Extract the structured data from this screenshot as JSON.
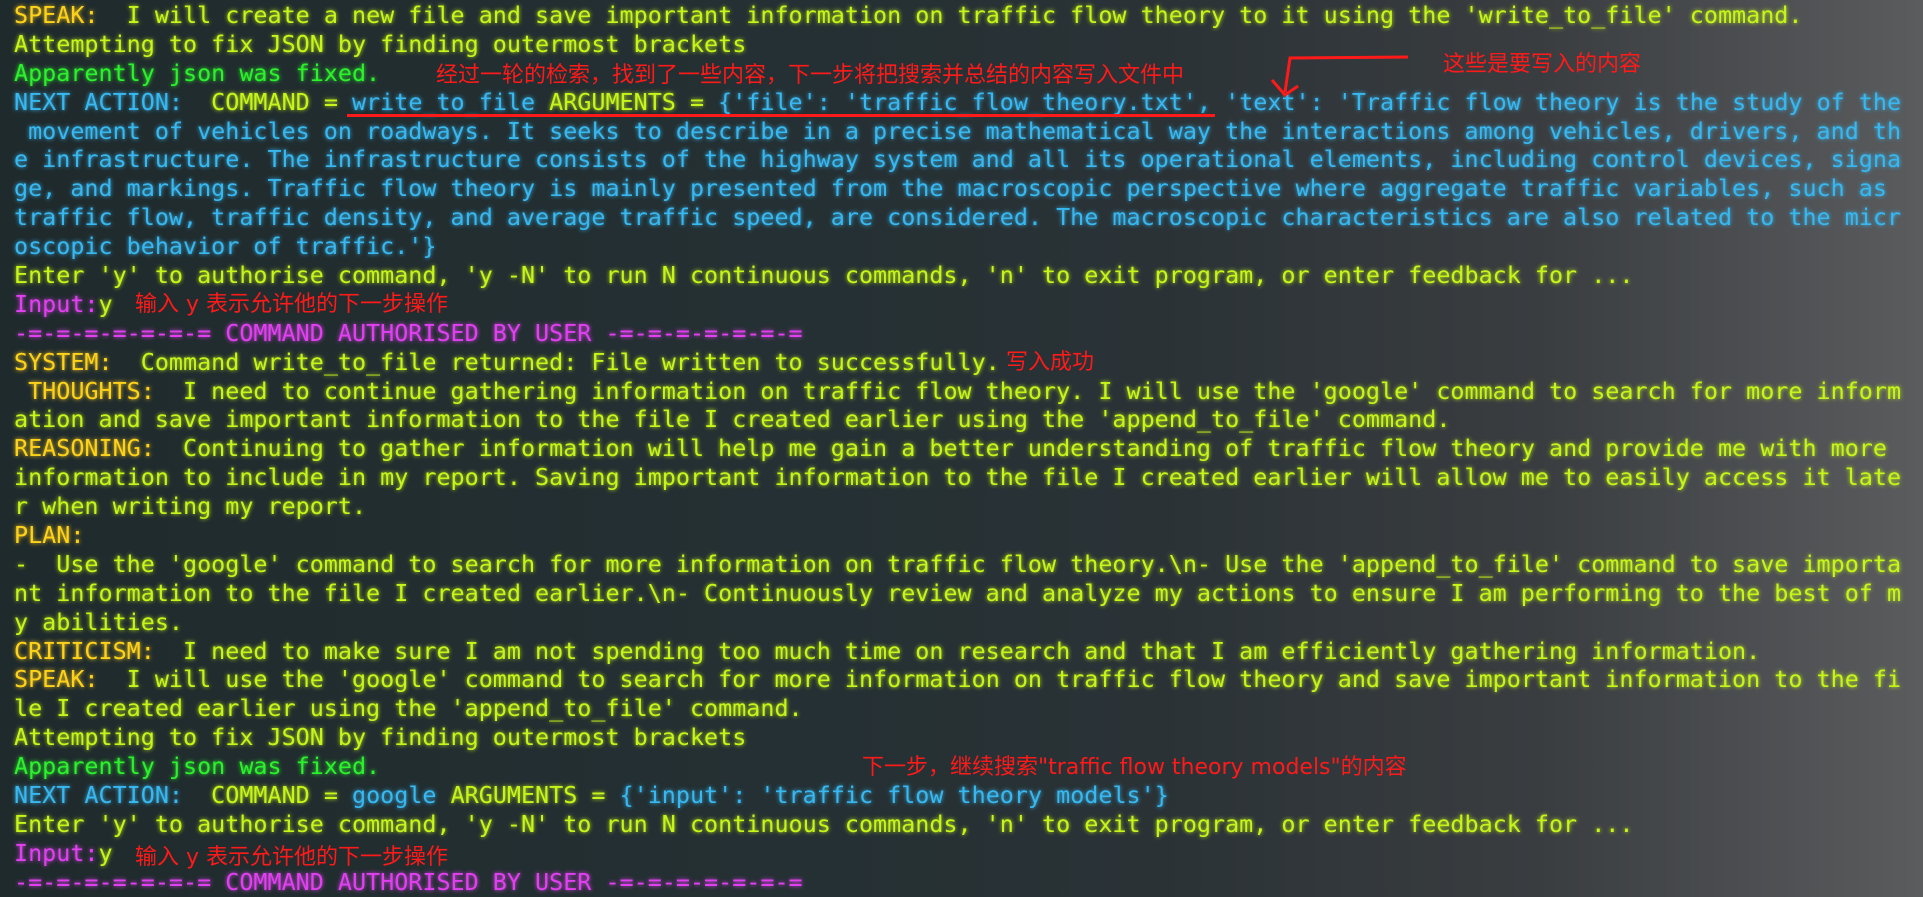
{
  "colors": {
    "label": "#ffd21a",
    "text": "#c6f51a",
    "green": "#2cf22c",
    "cyan": "#38b8f0",
    "magenta": "#e040f0",
    "annotation": "#ff1a1a"
  },
  "lines": [
    [
      [
        "label",
        "SPEAK:"
      ],
      [
        "text",
        "  I will create a new file and save important information on traffic flow theory to it using the 'write_to_file' command."
      ]
    ],
    [
      [
        "text",
        "Attempting to fix JSON by finding outermost brackets"
      ]
    ],
    [
      [
        "green",
        "Apparently json was fixed."
      ]
    ],
    [
      [
        "cyan",
        "NEXT ACTION: "
      ],
      [
        "text",
        " COMMAND = "
      ],
      [
        "cyan",
        "write_to_file"
      ],
      [
        "text",
        " ARGUMENTS = "
      ],
      [
        "cyan",
        "{'file': 'traffic_flow_theory.txt', 'text': 'Traffic flow theory is the study of the"
      ]
    ],
    [
      [
        "cyan",
        " movement of vehicles on roadways. It seeks to describe in a precise mathematical way the interactions among vehicles, drivers, and th"
      ]
    ],
    [
      [
        "cyan",
        "e infrastructure. The infrastructure consists of the highway system and all its operational elements, including control devices, signa"
      ]
    ],
    [
      [
        "cyan",
        "ge, and markings. Traffic flow theory is mainly presented from the macroscopic perspective where aggregate traffic variables, such as"
      ]
    ],
    [
      [
        "cyan",
        "traffic flow, traffic density, and average traffic speed, are considered. The macroscopic characteristics are also related to the micr"
      ]
    ],
    [
      [
        "cyan",
        "oscopic behavior of traffic.'}"
      ]
    ],
    [
      [
        "text",
        "Enter 'y' to authorise command, 'y -N' to run N continuous commands, 'n' to exit program, or enter feedback for ..."
      ]
    ],
    [
      [
        "mag",
        "Input:"
      ],
      [
        "text",
        "y"
      ]
    ],
    [
      [
        "mag",
        "-=-=-=-=-=-=-= COMMAND AUTHORISED BY USER -=-=-=-=-=-=-="
      ]
    ],
    [
      [
        "label",
        "SYSTEM:"
      ],
      [
        "text",
        "  Command write_to_file returned: File written to successfully."
      ]
    ],
    [
      [
        "label",
        " THOUGHTS:"
      ],
      [
        "text",
        "  I need to continue gathering information on traffic flow theory. I will use the 'google' command to search for more inform"
      ]
    ],
    [
      [
        "text",
        "ation and save important information to the file I created earlier using the 'append_to_file' command."
      ]
    ],
    [
      [
        "label",
        "REASONING:"
      ],
      [
        "text",
        "  Continuing to gather information will help me gain a better understanding of traffic flow theory and provide me with more"
      ]
    ],
    [
      [
        "text",
        "information to include in my report. Saving important information to the file I created earlier will allow me to easily access it late"
      ]
    ],
    [
      [
        "text",
        "r when writing my report."
      ]
    ],
    [
      [
        "label",
        "PLAN:"
      ]
    ],
    [
      [
        "text",
        "-  Use the 'google' command to search for more information on traffic flow theory.\\n- Use the 'append_to_file' command to save importa"
      ]
    ],
    [
      [
        "text",
        "nt information to the file I created earlier.\\n- Continuously review and analyze my actions to ensure I am performing to the best of m"
      ]
    ],
    [
      [
        "text",
        "y abilities."
      ]
    ],
    [
      [
        "label",
        "CRITICISM:"
      ],
      [
        "text",
        "  I need to make sure I am not spending too much time on research and that I am efficiently gathering information."
      ]
    ],
    [
      [
        "label",
        "SPEAK:"
      ],
      [
        "text",
        "  I will use the 'google' command to search for more information on traffic flow theory and save important information to the fi"
      ]
    ],
    [
      [
        "text",
        "le I created earlier using the 'append_to_file' command."
      ]
    ],
    [
      [
        "text",
        "Attempting to fix JSON by finding outermost brackets"
      ]
    ],
    [
      [
        "green",
        "Apparently json was fixed."
      ]
    ],
    [
      [
        "cyan",
        "NEXT ACTION: "
      ],
      [
        "text",
        " COMMAND = "
      ],
      [
        "cyan",
        "google"
      ],
      [
        "text",
        " ARGUMENTS = "
      ],
      [
        "cyan",
        "{'input': 'traffic flow theory models'}"
      ]
    ],
    [
      [
        "text",
        "Enter 'y' to authorise command, 'y -N' to run N continuous commands, 'n' to exit program, or enter feedback for ..."
      ]
    ],
    [
      [
        "mag",
        "Input:"
      ],
      [
        "text",
        "y"
      ]
    ],
    [
      [
        "mag",
        "-=-=-=-=-=-=-= COMMAND AUTHORISED BY USER -=-=-=-=-=-=-="
      ]
    ]
  ],
  "annotations": {
    "search_summary": "经过一轮的检索，找到了一些内容，下一步将把搜索并总结的内容写入文件中",
    "content_to_write": "这些是要写入的内容",
    "input_y_1": "输入 y 表示允许他的下一步操作",
    "write_success": "写入成功",
    "next_search": "下一步，继续搜索\"traffic flow theory models\"的内容",
    "input_y_2": "输入 y 表示允许他的下一步操作"
  }
}
